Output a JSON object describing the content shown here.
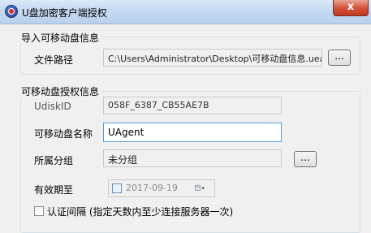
{
  "window": {
    "title": "U盘加密客户端授权",
    "close_label": "x"
  },
  "import_group": {
    "title": "导入可移动盘信息",
    "file_path_label": "文件路径",
    "file_path_value": "C:\\Users\\Administrator\\Desktop\\可移动盘信息.uea",
    "browse_label": "..."
  },
  "auth_group": {
    "title": "可移动盘授权信息",
    "udisk_id_label": "UdiskID",
    "udisk_id_value": "058F_6387_CB55AE7B",
    "name_label": "可移动盘名称",
    "name_value": "UAgent",
    "group_label": "所属分组",
    "group_value": "未分组",
    "group_browse_label": "...",
    "expiry_label": "有效期至",
    "expiry_value": "2017-09-19",
    "interval_label": "认证间隔 (指定天数内至少连接服务器一次)"
  }
}
